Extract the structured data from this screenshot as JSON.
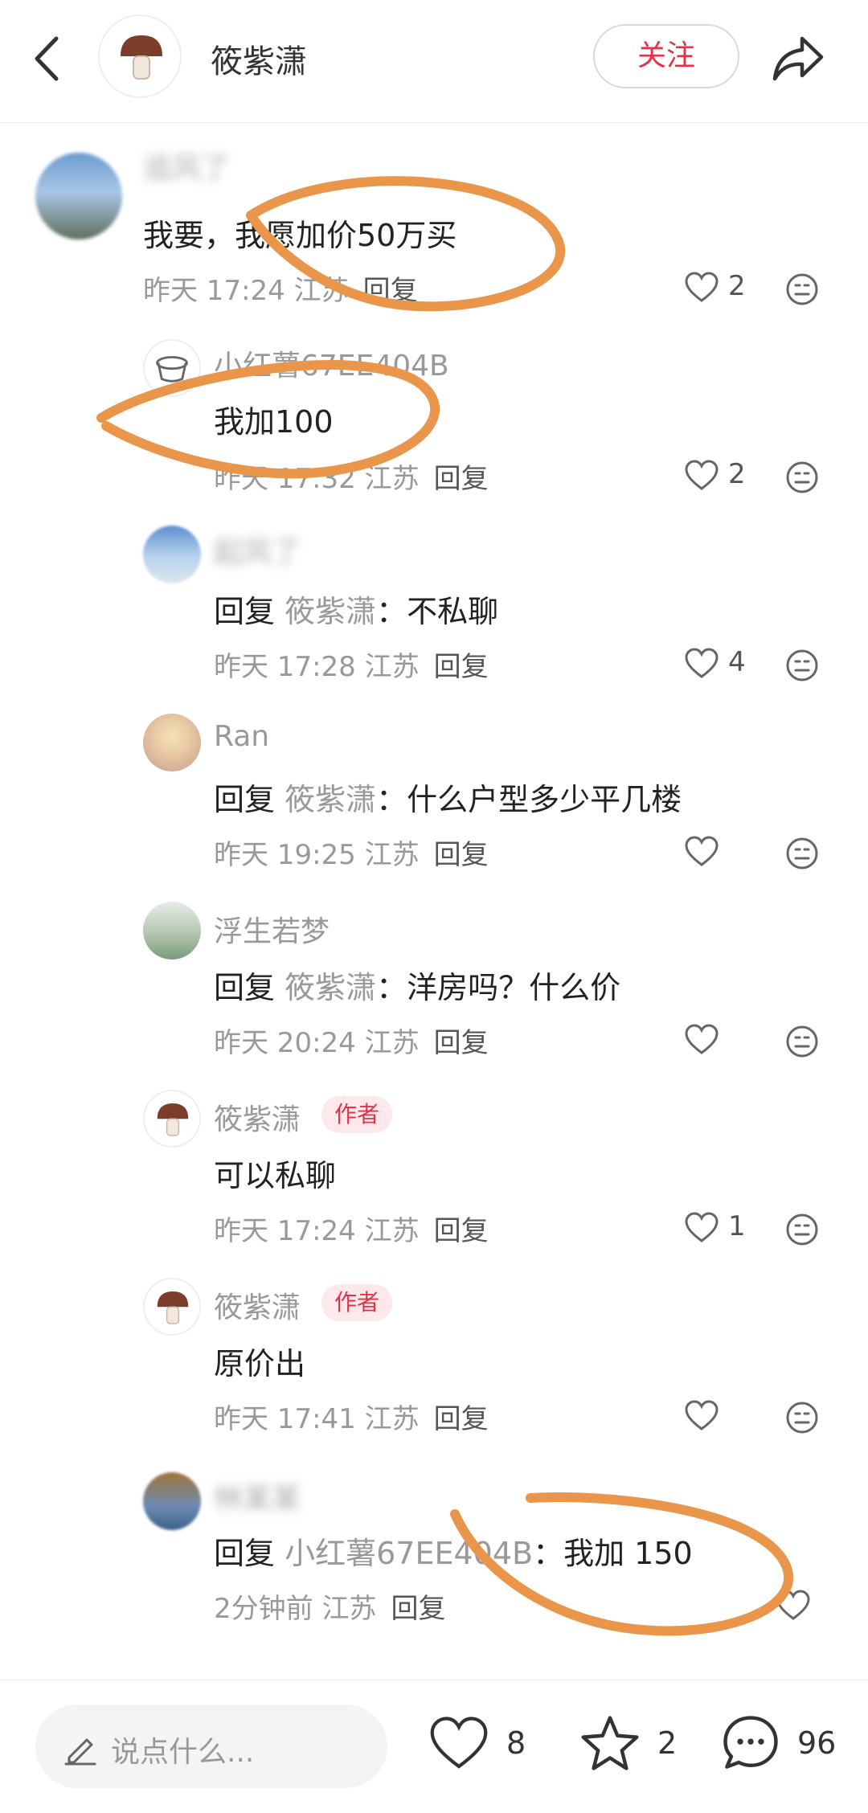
{
  "header": {
    "author_name": "筱紫潇",
    "follow_label": "关注"
  },
  "comments": [
    {
      "nickname": "追风了",
      "text": "我要，我愿加价50万买",
      "meta_time": "昨天 17:24 江苏",
      "reply_label": "回复",
      "likes": "2"
    },
    {
      "nickname": "小红薯67EE404B",
      "text": "我加100",
      "meta_time": "昨天 17:32 江苏",
      "reply_label": "回复",
      "likes": "2"
    },
    {
      "nickname": "起风了",
      "reply_prefix": "回复",
      "reply_to": "筱紫潇",
      "text": "：不私聊",
      "meta_time": "昨天 17:28 江苏",
      "reply_label": "回复",
      "likes": "4"
    },
    {
      "nickname": "Ran",
      "reply_prefix": "回复",
      "reply_to": "筱紫潇",
      "text": "：什么户型多少平几楼",
      "meta_time": "昨天 19:25 江苏",
      "reply_label": "回复",
      "likes": ""
    },
    {
      "nickname": "浮生若梦",
      "reply_prefix": "回复",
      "reply_to": "筱紫潇",
      "text": "：洋房吗？什么价",
      "meta_time": "昨天 20:24 江苏",
      "reply_label": "回复",
      "likes": ""
    },
    {
      "nickname": "筱紫潇",
      "author_tag": "作者",
      "text": "可以私聊",
      "meta_time": "昨天 17:24 江苏",
      "reply_label": "回复",
      "likes": "1"
    },
    {
      "nickname": "筱紫潇",
      "author_tag": "作者",
      "text": "原价出",
      "meta_time": "昨天 17:41 江苏",
      "reply_label": "回复",
      "likes": ""
    },
    {
      "nickname": "林某某",
      "reply_prefix": "回复",
      "reply_to": "小红薯67EE404B",
      "text": "：我加 150",
      "meta_time": "2分钟前 江苏",
      "reply_label": "回复",
      "likes": ""
    }
  ],
  "bottom_bar": {
    "input_placeholder": "说点什么...",
    "like_count": "8",
    "collect_count": "2",
    "comment_count": "96"
  },
  "colors": {
    "accent": "#e0344a",
    "annotation_orange": "#e9954a"
  },
  "icons": [
    "back-icon",
    "share-icon",
    "heart-icon",
    "emoji-icon",
    "pencil-icon",
    "star-icon",
    "comment-icon"
  ]
}
